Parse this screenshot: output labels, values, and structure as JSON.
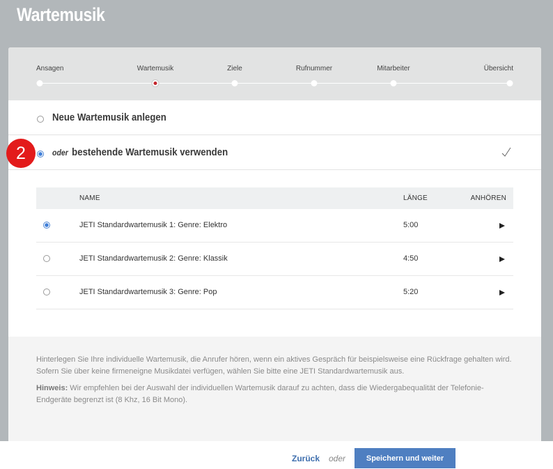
{
  "header": {
    "title": "Wartemusik"
  },
  "stepper": {
    "steps": [
      "Ansagen",
      "Wartemusik",
      "Ziele",
      "Rufnummer",
      "Mitarbeiter",
      "Übersicht"
    ],
    "active_index": 1
  },
  "options": {
    "new_label": "Neue Wartemusik anlegen",
    "existing_prefix": "oder",
    "existing_label": "bestehende Wartemusik verwenden",
    "selected": "existing"
  },
  "annotation_badge": "2",
  "table": {
    "headers": {
      "name": "NAME",
      "length": "LÄNGE",
      "listen": "ANHÖREN"
    },
    "rows": [
      {
        "name": "JETI Standardwartemusik 1: Genre: Elektro",
        "length": "5:00",
        "selected": true
      },
      {
        "name": "JETI Standardwartemusik 2: Genre: Klassik",
        "length": "4:50",
        "selected": false
      },
      {
        "name": "JETI Standardwartemusik 3: Genre: Pop",
        "length": "5:20",
        "selected": false
      }
    ]
  },
  "info": {
    "paragraph": "Hinterlegen Sie Ihre individuelle Wartemusik, die Anrufer hören, wenn ein aktives Gespräch für beispielsweise eine Rückfrage gehalten wird. Sofern Sie über keine firmeneigne Musikdatei verfügen, wählen Sie bitte eine JETI Standardwartemusik aus.",
    "hint_label": "Hinweis:",
    "hint_text": " Wir empfehlen bei der Auswahl der individuellen Wartemusik darauf zu achten, dass die Wiedergabequalität der Telefonie-Endgeräte begrenzt ist (8 Khz, 16 Bit Mono)."
  },
  "footer": {
    "back_label": "Zurück",
    "or_label": "oder",
    "save_label": "Speichern und weiter"
  },
  "colors": {
    "accent": "#4f7fc1",
    "active_step": "#c3262d",
    "badge": "#e31b1b"
  }
}
